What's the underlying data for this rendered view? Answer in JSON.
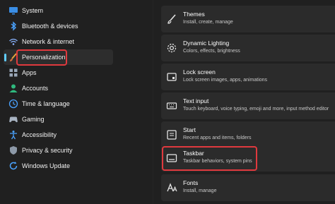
{
  "sidebar": {
    "items": [
      {
        "label": "System",
        "icon": "system-icon"
      },
      {
        "label": "Bluetooth & devices",
        "icon": "bluetooth-icon"
      },
      {
        "label": "Network & internet",
        "icon": "wifi-icon"
      },
      {
        "label": "Personalization",
        "icon": "brush-icon",
        "selected": true
      },
      {
        "label": "Apps",
        "icon": "apps-icon"
      },
      {
        "label": "Accounts",
        "icon": "accounts-icon"
      },
      {
        "label": "Time & language",
        "icon": "globe-clock-icon"
      },
      {
        "label": "Gaming",
        "icon": "gamepad-icon"
      },
      {
        "label": "Accessibility",
        "icon": "accessibility-icon"
      },
      {
        "label": "Privacy & security",
        "icon": "shield-icon"
      },
      {
        "label": "Windows Update",
        "icon": "update-icon"
      }
    ]
  },
  "main": {
    "cards": [
      {
        "title": "Themes",
        "desc": "Install, create, manage",
        "icon": "brush-icon"
      },
      {
        "title": "Dynamic Lighting",
        "desc": "Colors, effects, brightness",
        "icon": "gear-icon"
      },
      {
        "title": "Lock screen",
        "desc": "Lock screen images, apps, animations",
        "icon": "lock-screen-icon"
      },
      {
        "title": "Text input",
        "desc": "Touch keyboard, voice typing, emoji and more, input method editor",
        "icon": "keyboard-icon"
      },
      {
        "title": "Start",
        "desc": "Recent apps and items, folders",
        "icon": "start-icon"
      },
      {
        "title": "Taskbar",
        "desc": "Taskbar behaviors, system pins",
        "icon": "taskbar-icon",
        "highlighted": true
      },
      {
        "title": "Fonts",
        "desc": "Install, manage",
        "icon": "fonts-icon"
      }
    ]
  },
  "colors": {
    "background": "#202020",
    "card": "#2b2b2b",
    "accent": "#60cdff",
    "highlight_box": "#e0393e"
  }
}
